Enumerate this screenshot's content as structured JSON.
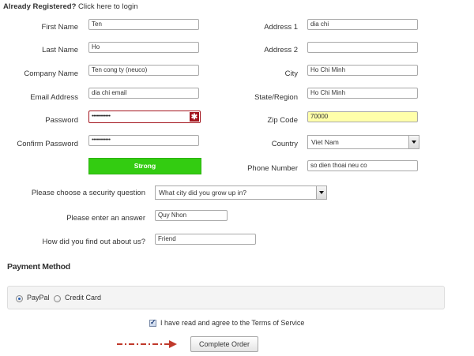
{
  "header": {
    "registered_prefix": "Already Registered?",
    "login_link": "Click here to login"
  },
  "form": {
    "first_name": {
      "label": "First Name",
      "value": "Ten"
    },
    "last_name": {
      "label": "Last Name",
      "value": "Ho"
    },
    "company_name": {
      "label": "Company Name",
      "value": "Ten cong ty (neuco)"
    },
    "email": {
      "label": "Email Address",
      "value": "dia chi email"
    },
    "password": {
      "label": "Password",
      "value": "••••••••••••"
    },
    "confirm_password": {
      "label": "Confirm Password",
      "value": "••••••••••••"
    },
    "strength": {
      "label": "Strong",
      "color": "#33cc11"
    },
    "address1": {
      "label": "Address 1",
      "value": "dia chi"
    },
    "address2": {
      "label": "Address 2",
      "value": ""
    },
    "city": {
      "label": "City",
      "value": "Ho Chi Minh"
    },
    "state": {
      "label": "State/Region",
      "value": "Ho Chi Minh"
    },
    "zip": {
      "label": "Zip Code",
      "value": "70000",
      "highlight": "#ffffaa"
    },
    "country": {
      "label": "Country",
      "value": "Viet Nam"
    },
    "phone": {
      "label": "Phone Number",
      "value": "so dien thoai neu co"
    },
    "security_question": {
      "label": "Please choose a security question",
      "value": "What city did you grow up in?"
    },
    "answer": {
      "label": "Please enter an answer",
      "value": "Quy Nhon"
    },
    "referral": {
      "label": "How did you find out about us?",
      "value": "Friend"
    }
  },
  "payment": {
    "title": "Payment Method",
    "options": [
      {
        "label": "PayPal",
        "selected": true
      },
      {
        "label": "Credit Card",
        "selected": false
      }
    ]
  },
  "terms": {
    "label": "I have read and agree to the Terms of Service",
    "checked": true
  },
  "submit": {
    "label": "Complete Order"
  },
  "arrow_color": "#c0392b"
}
